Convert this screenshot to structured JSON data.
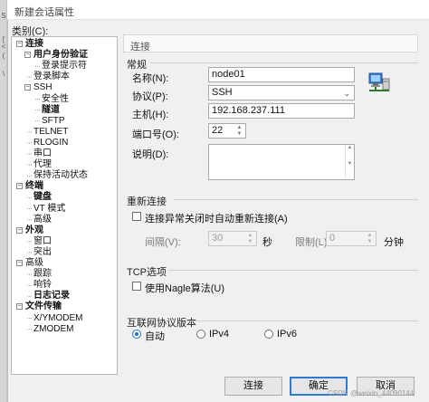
{
  "window": {
    "title": "新建会话属性"
  },
  "left_strip": {
    "glyphs": [
      "S",
      "[",
      "<",
      "(",
      "\\"
    ]
  },
  "category_label": "类别(C):",
  "tree": [
    {
      "label": "连接",
      "bold": true,
      "expander": "−",
      "depth": 0
    },
    {
      "label": "用户身份验证",
      "bold": true,
      "expander": "−",
      "depth": 1
    },
    {
      "label": "登录提示符",
      "bold": false,
      "expander": "",
      "depth": 2
    },
    {
      "label": "登录脚本",
      "bold": false,
      "expander": "",
      "depth": 1
    },
    {
      "label": "SSH",
      "bold": false,
      "expander": "−",
      "depth": 1
    },
    {
      "label": "安全性",
      "bold": false,
      "expander": "",
      "depth": 2
    },
    {
      "label": "隧道",
      "bold": true,
      "expander": "",
      "depth": 2
    },
    {
      "label": "SFTP",
      "bold": false,
      "expander": "",
      "depth": 2
    },
    {
      "label": "TELNET",
      "bold": false,
      "expander": "",
      "depth": 1
    },
    {
      "label": "RLOGIN",
      "bold": false,
      "expander": "",
      "depth": 1
    },
    {
      "label": "串口",
      "bold": false,
      "expander": "",
      "depth": 1
    },
    {
      "label": "代理",
      "bold": false,
      "expander": "",
      "depth": 1
    },
    {
      "label": "保持活动状态",
      "bold": false,
      "expander": "",
      "depth": 1
    },
    {
      "label": "终端",
      "bold": true,
      "expander": "−",
      "depth": 0
    },
    {
      "label": "键盘",
      "bold": true,
      "expander": "",
      "depth": 1
    },
    {
      "label": "VT 模式",
      "bold": false,
      "expander": "",
      "depth": 1
    },
    {
      "label": "高级",
      "bold": false,
      "expander": "",
      "depth": 1
    },
    {
      "label": "外观",
      "bold": true,
      "expander": "−",
      "depth": 0
    },
    {
      "label": "窗口",
      "bold": false,
      "expander": "",
      "depth": 1
    },
    {
      "label": "突出",
      "bold": false,
      "expander": "",
      "depth": 1
    },
    {
      "label": "高级",
      "bold": false,
      "expander": "−",
      "depth": 0
    },
    {
      "label": "跟踪",
      "bold": false,
      "expander": "",
      "depth": 1
    },
    {
      "label": "响铃",
      "bold": false,
      "expander": "",
      "depth": 1
    },
    {
      "label": "日志记录",
      "bold": true,
      "expander": "",
      "depth": 1
    },
    {
      "label": "文件传输",
      "bold": true,
      "expander": "−",
      "depth": 0
    },
    {
      "label": "X/YMODEM",
      "bold": false,
      "expander": "",
      "depth": 1
    },
    {
      "label": "ZMODEM",
      "bold": false,
      "expander": "",
      "depth": 1
    }
  ],
  "section_header": "连接",
  "general": {
    "title": "常规",
    "name_label": "名称(N):",
    "name_value": "node01",
    "protocol_label": "协议(P):",
    "protocol_value": "SSH",
    "host_label": "主机(H):",
    "host_value": "192.168.237.111",
    "port_label": "端口号(O):",
    "port_value": "22",
    "desc_label": "说明(D):",
    "desc_value": ""
  },
  "reconnect": {
    "title": "重新连接",
    "checkbox_label": "连接异常关闭时自动重新连接(A)",
    "checked": false,
    "interval_label": "间隔(V):",
    "interval_value": "30",
    "interval_unit": "秒",
    "limit_label": "限制(L):",
    "limit_value": "0",
    "limit_unit": "分钟"
  },
  "tcp": {
    "title": "TCP选项",
    "nagle_label": "使用Nagle算法(U)",
    "checked": false
  },
  "ipver": {
    "title": "互联网协议版本",
    "options": [
      "自动",
      "IPv4",
      "IPv6"
    ],
    "selected": "自动"
  },
  "buttons": {
    "connect": "连接",
    "ok": "确定",
    "cancel": "取消"
  },
  "watermark": "CSDN @weixin_44090144",
  "colors": {
    "accent": "#1f6dd6",
    "tree_bg": "#ffffff",
    "dialog_bg": "#f0f0f0"
  }
}
